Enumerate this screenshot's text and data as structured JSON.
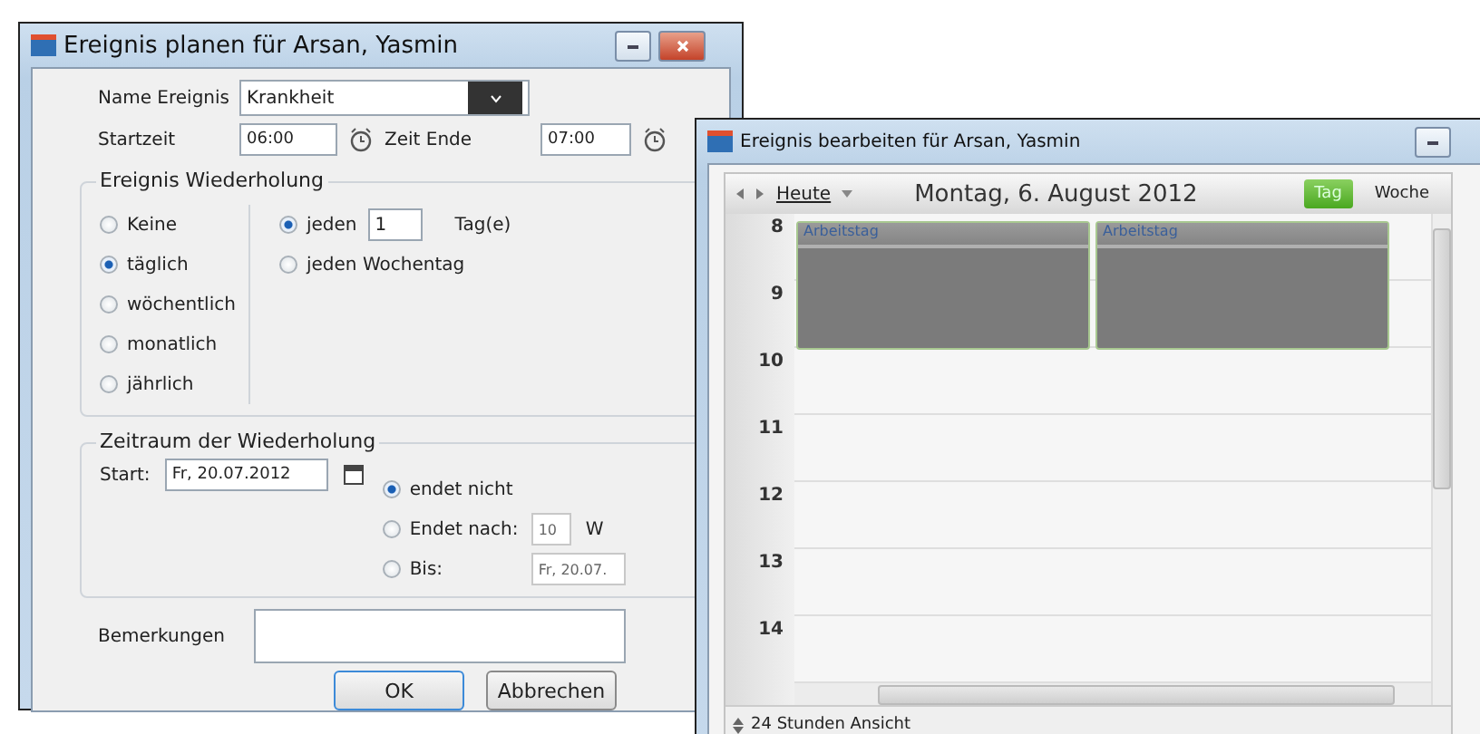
{
  "window_1": {
    "title": "Ereignis planen für Arsan, Yasmin",
    "name_label": "Name Ereignis",
    "name_value": "Krankheit",
    "start_label": "Startzeit",
    "start_value": "06:00",
    "end_label": "Zeit Ende",
    "end_value": "07:00",
    "recurrence": {
      "title": "Ereignis Wiederholung",
      "patterns": [
        {
          "label": "Keine",
          "selected": false
        },
        {
          "label": "täglich",
          "selected": true
        },
        {
          "label": "wöchentlich",
          "selected": false
        },
        {
          "label": "monatlich",
          "selected": false
        },
        {
          "label": "jährlich",
          "selected": false
        }
      ],
      "daily_options": [
        {
          "label": "jeden",
          "selected": true,
          "value": "1",
          "unit": "Tag(e)"
        },
        {
          "label": "jeden Wochentag",
          "selected": false
        }
      ]
    },
    "range": {
      "title": "Zeitraum der Wiederholung",
      "start_label": "Start:",
      "start_value": "Fr, 20.07.2012",
      "end_options": [
        {
          "label": "endet nicht",
          "selected": true
        },
        {
          "label": "Endet nach:",
          "selected": false,
          "value": "10",
          "unit": "W"
        },
        {
          "label": "Bis:",
          "selected": false,
          "value": "Fr, 20.07."
        }
      ]
    },
    "remarks_label": "Bemerkungen",
    "buttons": [
      {
        "label": "OK",
        "focused": true
      },
      {
        "label": "Abbrechen",
        "focused": false
      }
    ]
  },
  "window_2": {
    "title": "Ereignis bearbeiten für Arsan, Yasmin",
    "today": "Heute",
    "date": "Montag, 6. August 2012",
    "views": [
      {
        "label": "Tag",
        "selected": true
      },
      {
        "label": "Woche",
        "selected": false
      }
    ],
    "hours": [
      "8",
      "9",
      "10",
      "11",
      "12",
      "13",
      "14"
    ],
    "events": [
      {
        "title": "Arbeitstag"
      },
      {
        "title": "Arbeitstag"
      }
    ],
    "footer": "24 Stunden Ansicht"
  }
}
